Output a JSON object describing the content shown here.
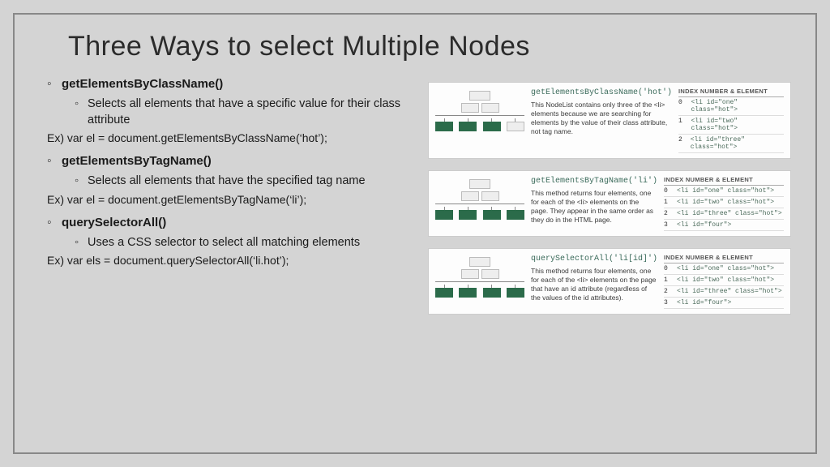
{
  "title": "Three Ways to select Multiple Nodes",
  "methods": [
    {
      "name": "getElementsByClassName()",
      "desc": "Selects all elements that have a specific value for their class attribute",
      "example": "Ex)  var el = document.getElementsByClassName(‘hot’);"
    },
    {
      "name": "getElementsByTagName()",
      "desc": "Selects all elements that have the specified tag name",
      "example": "Ex)   var el = document.getElementsByTagName(‘li’);"
    },
    {
      "name": "querySelectorAll()",
      "desc": "Uses a CSS selector to select all matching elements",
      "example": "Ex) var els = document.querySelectorAll(‘li.hot’);"
    }
  ],
  "cards": [
    {
      "call": "getElementsByClassName('hot')",
      "blurb": "This NodeList contains only three of the <li> elements because we are searching for elements by the value of their class attribute, not tag name.",
      "table_header": "INDEX NUMBER & ELEMENT",
      "leaves_hot": [
        true,
        true,
        true,
        false
      ],
      "rows": [
        {
          "idx": "0",
          "el": "<li id=\"one\" class=\"hot\">"
        },
        {
          "idx": "1",
          "el": "<li id=\"two\" class=\"hot\">"
        },
        {
          "idx": "2",
          "el": "<li id=\"three\" class=\"hot\">"
        }
      ]
    },
    {
      "call": "getElementsByTagName('li')",
      "blurb": "This method returns four elements, one for each of the <li> elements on the page. They appear in the same order as they do in the HTML page.",
      "table_header": "INDEX NUMBER & ELEMENT",
      "leaves_hot": [
        true,
        true,
        true,
        true
      ],
      "rows": [
        {
          "idx": "0",
          "el": "<li id=\"one\" class=\"hot\">"
        },
        {
          "idx": "1",
          "el": "<li id=\"two\" class=\"hot\">"
        },
        {
          "idx": "2",
          "el": "<li id=\"three\" class=\"hot\">"
        },
        {
          "idx": "3",
          "el": "<li id=\"four\">"
        }
      ]
    },
    {
      "call": "querySelectorAll('li[id]')",
      "blurb": "This method returns four elements, one for each of the <li> elements on the page that have an id attribute (regardless of the values of the id attributes).",
      "table_header": "INDEX NUMBER & ELEMENT",
      "leaves_hot": [
        true,
        true,
        true,
        true
      ],
      "rows": [
        {
          "idx": "0",
          "el": "<li id=\"one\" class=\"hot\">"
        },
        {
          "idx": "1",
          "el": "<li id=\"two\" class=\"hot\">"
        },
        {
          "idx": "2",
          "el": "<li id=\"three\" class=\"hot\">"
        },
        {
          "idx": "3",
          "el": "<li id=\"four\">"
        }
      ]
    }
  ]
}
